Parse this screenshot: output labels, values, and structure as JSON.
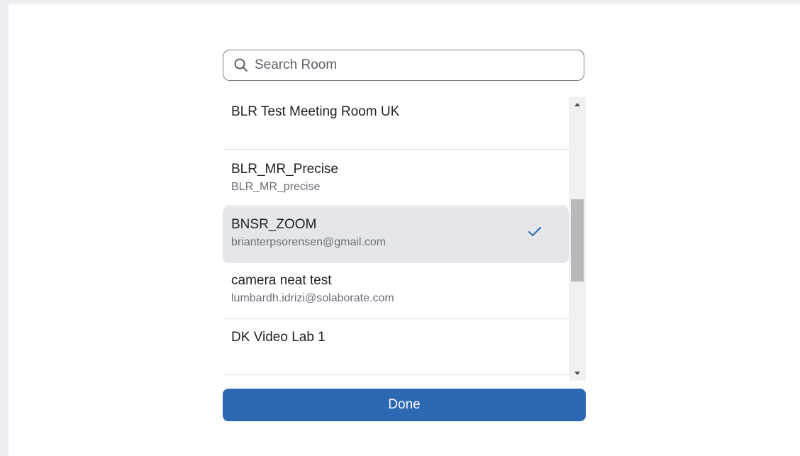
{
  "search": {
    "placeholder": "Search Room",
    "value": "",
    "icon": "search-icon"
  },
  "rooms": [
    {
      "name": "BLR Test Meeting Room UK",
      "email": "",
      "selected": false
    },
    {
      "name": "BLR_MR_Precise",
      "email": "BLR_MR_precise",
      "selected": false
    },
    {
      "name": "BNSR_ZOOM",
      "email": "brianterpsorensen@gmail.com",
      "selected": true
    },
    {
      "name": "camera neat test",
      "email": "lumbardh.idrizi@solaborate.com",
      "selected": false
    },
    {
      "name": "DK Video Lab 1",
      "email": "",
      "selected": false
    }
  ],
  "selected_icon": "check-icon",
  "done_label": "Done",
  "colors": {
    "accent": "#2d68b3",
    "check": "#2d68b3",
    "selected_row": "#e4e6ea",
    "page_bg": "#eceef1"
  }
}
